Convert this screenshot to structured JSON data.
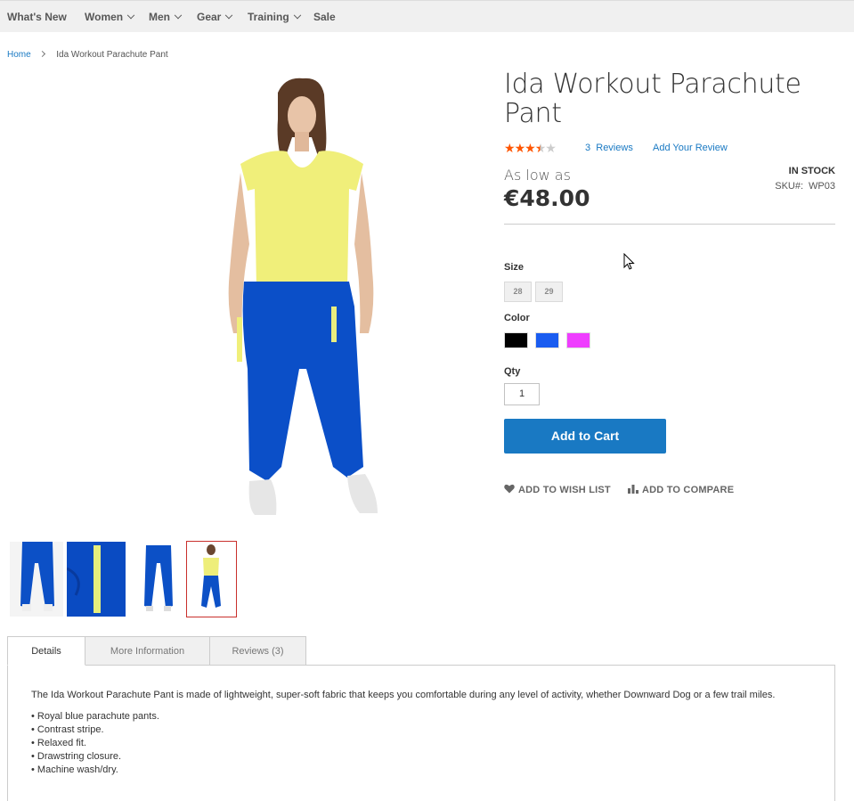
{
  "nav": {
    "items": [
      {
        "label": "What's New",
        "has_dropdown": false
      },
      {
        "label": "Women",
        "has_dropdown": true
      },
      {
        "label": "Men",
        "has_dropdown": true
      },
      {
        "label": "Gear",
        "has_dropdown": true
      },
      {
        "label": "Training",
        "has_dropdown": true
      },
      {
        "label": "Sale",
        "has_dropdown": false
      }
    ]
  },
  "breadcrumb": {
    "home": "Home",
    "current": "Ida Workout Parachute Pant"
  },
  "product": {
    "title": "Ida Workout Parachute Pant",
    "rating": {
      "stars_filled": 3.5,
      "stars_total": 5,
      "color": "#ff5501"
    },
    "reviews_count": "3",
    "reviews_label": "Reviews",
    "add_review": "Add Your Review",
    "as_low_as": "As low as",
    "price": "€48.00",
    "stock": "IN STOCK",
    "sku_label": "SKU#:",
    "sku": "WP03",
    "size_label": "Size",
    "sizes": [
      "28",
      "29"
    ],
    "color_label": "Color",
    "colors": [
      "#000000",
      "#1a5cf0",
      "#ef3dff"
    ],
    "qty_label": "Qty",
    "qty": "1",
    "add_to_cart": "Add to Cart",
    "wishlist": "ADD TO WISH LIST",
    "compare": "ADD TO COMPARE",
    "accent_color": "#1979c3"
  },
  "tabs": [
    {
      "label": "Details",
      "active": true
    },
    {
      "label": "More Information",
      "active": false
    },
    {
      "label": "Reviews (3)",
      "active": false
    }
  ],
  "details": {
    "description": "The Ida Workout Parachute Pant is made of lightweight, super-soft fabric that keeps you comfortable during any level of activity, whether Downward Dog or a few trail miles.",
    "bullets": [
      "Royal blue parachute pants.",
      "Contrast stripe.",
      "Relaxed fit.",
      "Drawstring closure.",
      "Machine wash/dry."
    ]
  }
}
